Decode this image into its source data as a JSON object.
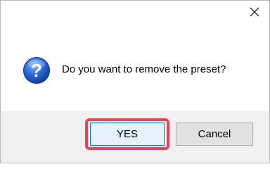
{
  "dialog": {
    "message": "Do you want to remove the preset?",
    "icon": "question-icon",
    "buttons": {
      "yes_label": "YES",
      "cancel_label": "Cancel"
    },
    "highlight_color": "#e8425a",
    "accent_color": "#0078d7"
  }
}
